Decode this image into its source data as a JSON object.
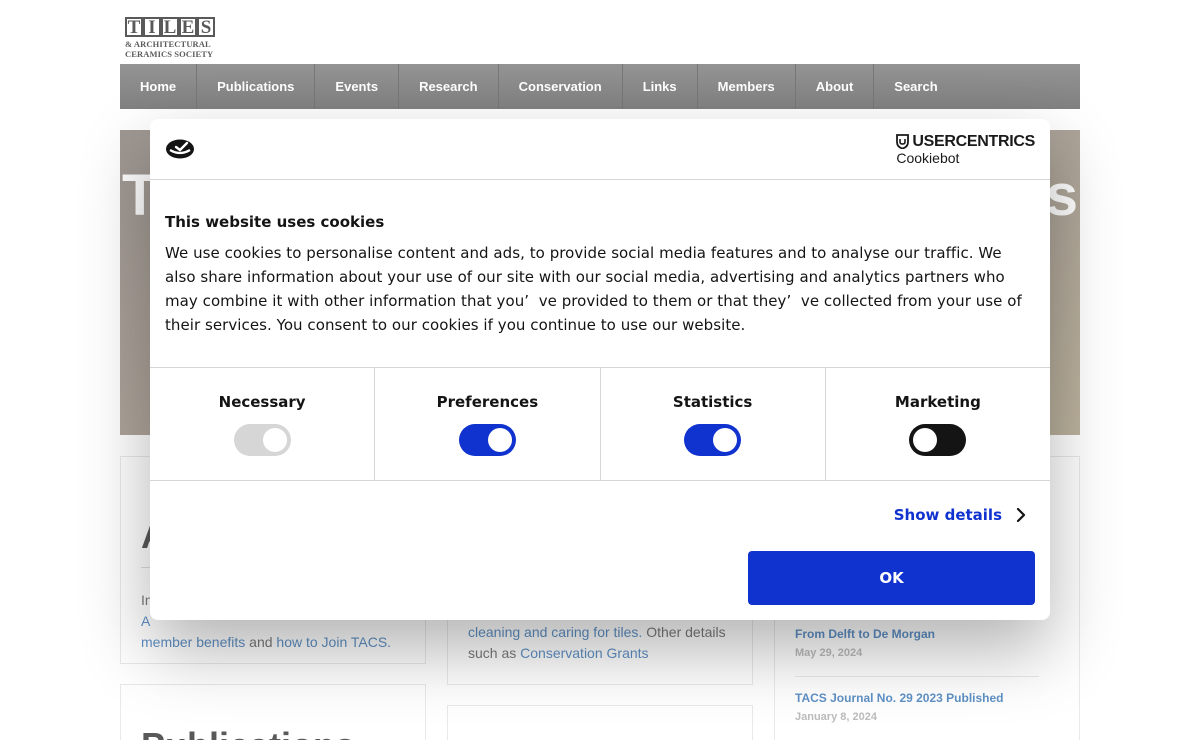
{
  "site": {
    "logo_big": [
      "T",
      "I",
      "L",
      "E",
      "S"
    ],
    "logo_line1": "& ARCHITECTURAL",
    "logo_line2": "CERAMICS SOCIETY"
  },
  "nav": {
    "items": [
      {
        "label": "Home"
      },
      {
        "label": "Publications"
      },
      {
        "label": "Events"
      },
      {
        "label": "Research"
      },
      {
        "label": "Conservation"
      },
      {
        "label": "Links"
      },
      {
        "label": "Members"
      },
      {
        "label": "About"
      },
      {
        "label": "Search"
      }
    ]
  },
  "hero": {
    "left_text": "T",
    "right_text": "s"
  },
  "cards": {
    "about": {
      "heading": "A",
      "line1_prefix": "In",
      "line2_prefix": "A",
      "benefits_link": "member benefits",
      "and": " and ",
      "join_link": "how to Join TACS."
    },
    "conservation": {
      "cleaning_link": "cleaning and caring for tiles.",
      "other": " Other details such as ",
      "grants_link": "Conservation Grants"
    },
    "news": [
      {
        "title": "From Delft to De Morgan",
        "date": "May 29, 2024"
      },
      {
        "title": "TACS Journal No. 29 2023 Published",
        "date": "January 8, 2024"
      }
    ],
    "publications": {
      "heading": "Publications"
    }
  },
  "cookie": {
    "brand_main": "USERCENTRICS",
    "brand_sub": "Cookiebot",
    "title": "This website uses cookies",
    "text": "We use cookies to personalise content and ads, to provide social media features and to analyse our traffic. We also share information about your use of our site with our social media, advertising and analytics partners who may combine it with other information that you’  ve provided to them or that they’  ve collected from your use of their services. You consent to our cookies if you continue to use our website.",
    "toggles": [
      {
        "label": "Necessary",
        "state": "on-disabled",
        "color": "#d6d6d6"
      },
      {
        "label": "Preferences",
        "state": "on",
        "color": "#1032cf"
      },
      {
        "label": "Statistics",
        "state": "on",
        "color": "#1032cf"
      },
      {
        "label": "Marketing",
        "state": "off",
        "color": "#141414"
      }
    ],
    "show_details": "Show details",
    "ok": "OK",
    "accent": "#1032cf"
  }
}
